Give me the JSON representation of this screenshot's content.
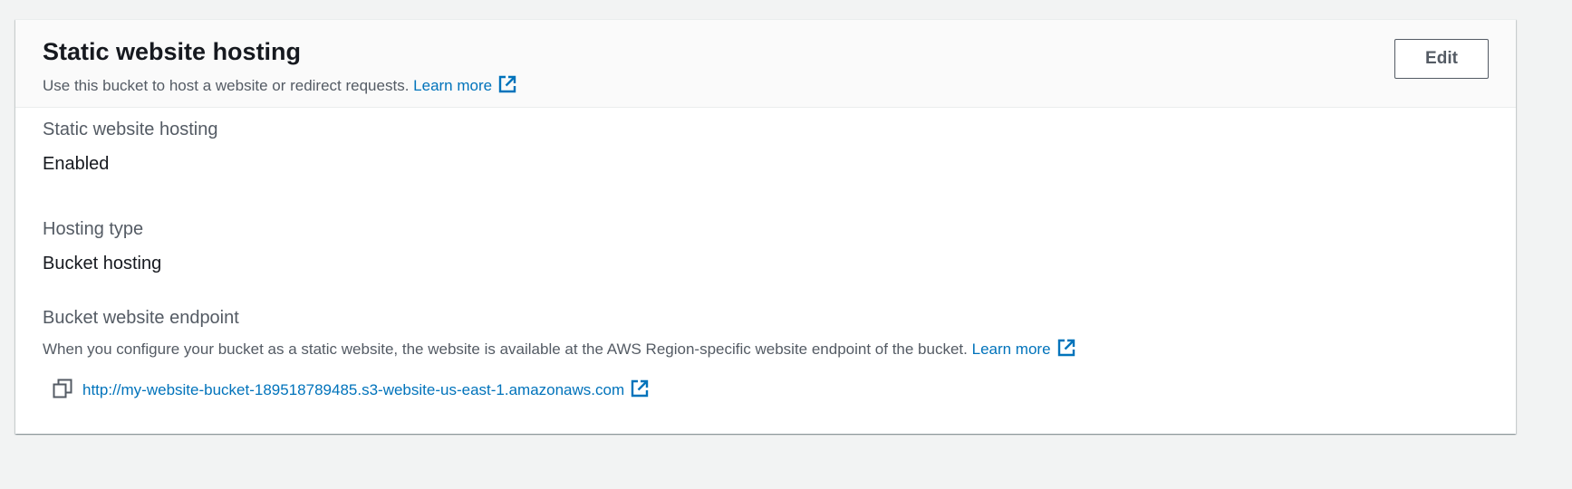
{
  "panel": {
    "title": "Static website hosting",
    "description": "Use this bucket to host a website or redirect requests.",
    "learn_more": "Learn more",
    "edit_label": "Edit"
  },
  "fields": {
    "hosting": {
      "label": "Static website hosting",
      "value": "Enabled"
    },
    "hosting_type": {
      "label": "Hosting type",
      "value": "Bucket hosting"
    },
    "endpoint": {
      "label": "Bucket website endpoint",
      "description": "When you configure your bucket as a static website, the website is available at the AWS Region-specific website endpoint of the bucket.",
      "learn_more": "Learn more",
      "url": "http://my-website-bucket-189518789485.s3-website-us-east-1.amazonaws.com"
    }
  },
  "icons": {
    "external_link": "external-link-icon",
    "copy": "copy-icon"
  },
  "colors": {
    "link": "#0073bb",
    "label": "#545b64",
    "text": "#16191f",
    "header_bg": "#fafafa",
    "page_bg": "#f2f3f3"
  }
}
